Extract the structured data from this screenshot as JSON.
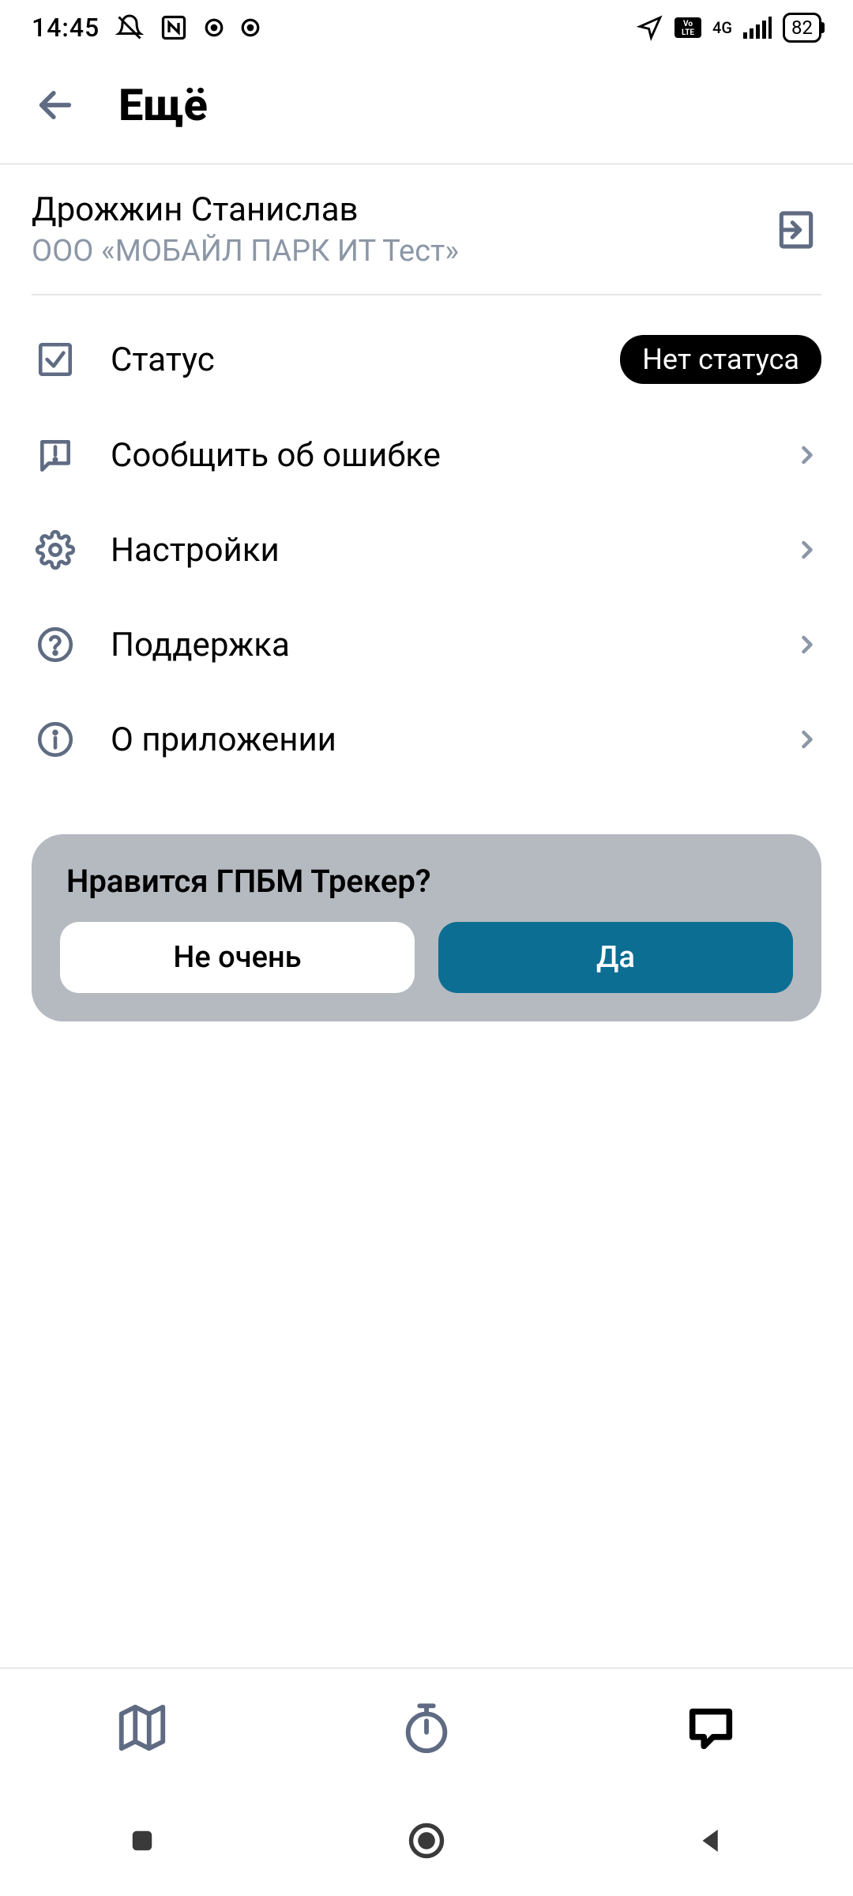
{
  "status_bar": {
    "time": "14:45",
    "battery": "82",
    "network_label": "4G"
  },
  "header": {
    "title": "Ещё"
  },
  "profile": {
    "name": "Дрожжин Станислав",
    "org": "ООО «МОБАЙЛ ПАРК ИТ Тест»"
  },
  "menu": {
    "status_label": "Статус",
    "status_value": "Нет статуса",
    "report_label": "Сообщить об ошибке",
    "settings_label": "Настройки",
    "support_label": "Поддержка",
    "about_label": "О приложении"
  },
  "feedback": {
    "title": "Нравится ГПБМ Трекер?",
    "no_label": "Не очень",
    "yes_label": "Да"
  }
}
